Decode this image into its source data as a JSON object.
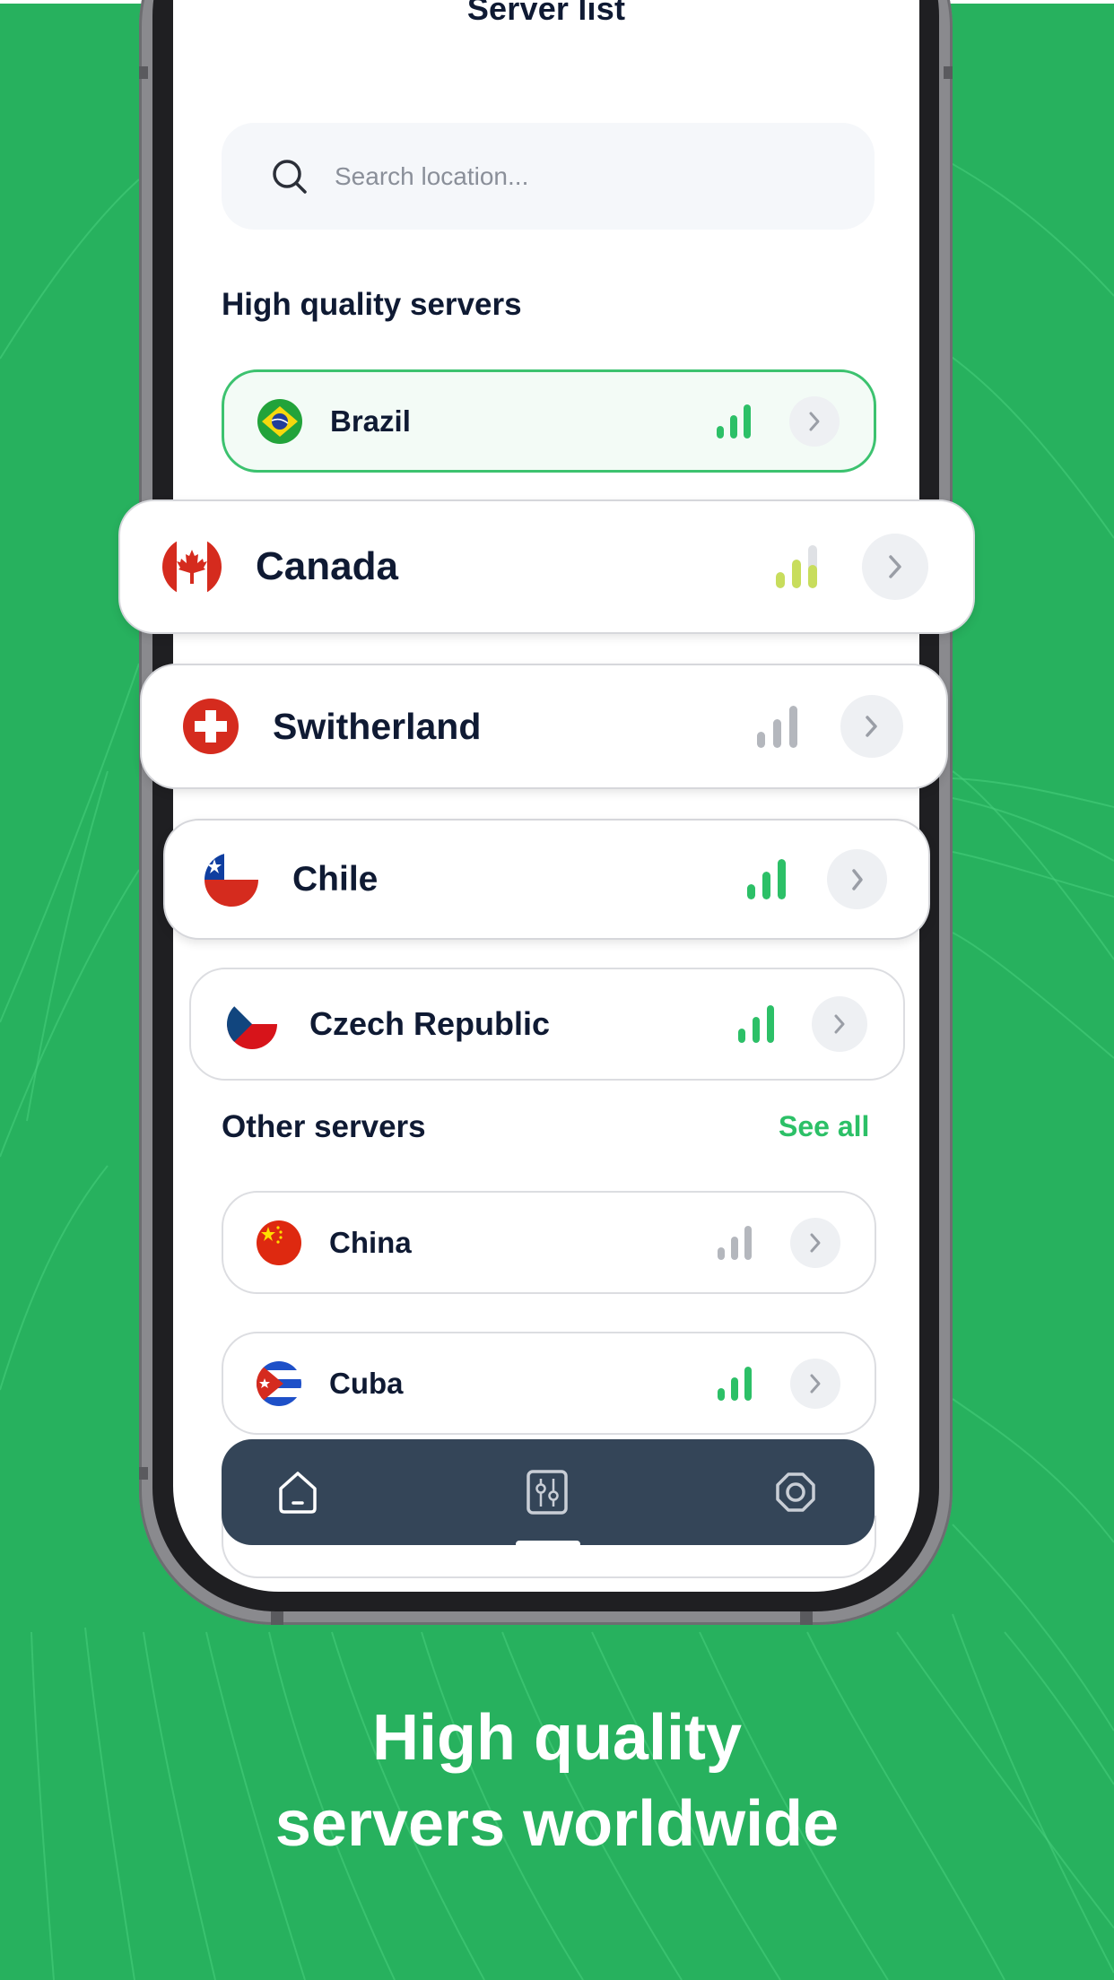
{
  "header": {
    "title": "Server list",
    "back_icon": "chevron-left-icon",
    "settings_icon": "settings-octagon-icon"
  },
  "search": {
    "placeholder": "Search location...",
    "value": "",
    "icon": "search-icon"
  },
  "sections": {
    "high_quality": {
      "title": "High quality servers",
      "servers": [
        {
          "name": "Brazil",
          "flag": "brazil-flag",
          "signal_bars": 3,
          "signal_level": 1.0,
          "signal_color": "#2cc067",
          "selected": true
        },
        {
          "name": "Canada",
          "flag": "canada-flag",
          "signal_bars": 3,
          "signal_level": 0.85,
          "signal_color": "#c8dd5c",
          "selected": false
        },
        {
          "name": "Switherland",
          "flag": "switzerland-flag",
          "signal_bars": 3,
          "signal_level": 1.0,
          "signal_color": "#b4b7bd",
          "selected": false
        },
        {
          "name": "Chile",
          "flag": "chile-flag",
          "signal_bars": 3,
          "signal_level": 1.0,
          "signal_color": "#2cc067",
          "selected": false
        },
        {
          "name": "Czech Republic",
          "flag": "czech-flag",
          "signal_bars": 3,
          "signal_level": 1.0,
          "signal_color": "#2cc067",
          "selected": false
        }
      ]
    },
    "other": {
      "title": "Other servers",
      "see_all_label": "See all",
      "servers": [
        {
          "name": "China",
          "flag": "china-flag",
          "signal_bars": 3,
          "signal_level": 1.0,
          "signal_color": "#b4b7bd"
        },
        {
          "name": "Cuba",
          "flag": "cuba-flag",
          "signal_bars": 3,
          "signal_level": 1.0,
          "signal_color": "#2cc067"
        }
      ]
    }
  },
  "bottom_nav": {
    "items": [
      {
        "name": "home",
        "icon": "home-icon"
      },
      {
        "name": "filters",
        "icon": "sliders-icon"
      },
      {
        "name": "settings",
        "icon": "settings-octagon-icon"
      }
    ]
  },
  "tagline": {
    "line1": "High quality",
    "line2": "servers worldwide"
  },
  "colors": {
    "background": "#27b15e",
    "accent": "#2cc067",
    "text_dark": "#0f1a33",
    "nav_bg": "#344558"
  }
}
